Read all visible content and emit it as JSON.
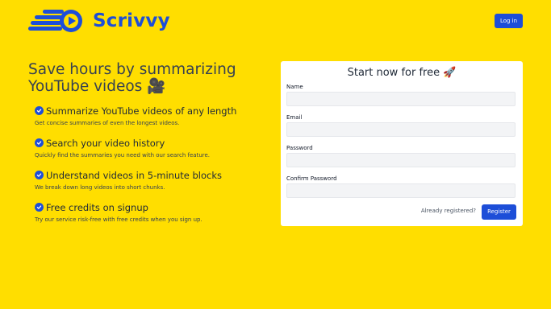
{
  "header": {
    "brand": "Scrivvy",
    "login_label": "Log in",
    "brand_color": "#1d4ed8"
  },
  "hero": {
    "title": "Save hours by summarizing YouTube videos 🎥"
  },
  "features": [
    {
      "title": "Summarize YouTube videos of any length",
      "desc": "Get concise summaries of even the longest videos.",
      "icon": "check-circle-icon"
    },
    {
      "title": "Search your video history",
      "desc": "Quickly find the summaries you need with our search feature.",
      "icon": "check-circle-icon"
    },
    {
      "title": "Understand videos in 5-minute blocks",
      "desc": "We break down long videos into short chunks.",
      "icon": "check-circle-icon"
    },
    {
      "title": "Free credits on signup",
      "desc": "Try our service risk-free with free credits when you sign up.",
      "icon": "check-circle-icon"
    }
  ],
  "form": {
    "title": "Start now for free 🚀",
    "fields": [
      {
        "label": "Name",
        "value": "",
        "placeholder": ""
      },
      {
        "label": "Email",
        "value": "",
        "placeholder": ""
      },
      {
        "label": "Password",
        "value": "",
        "placeholder": ""
      },
      {
        "label": "Confirm Password",
        "value": "",
        "placeholder": ""
      }
    ],
    "already_label": "Already registered?",
    "register_label": "Register"
  },
  "colors": {
    "background": "#ffde00",
    "accent": "#1d4ed8",
    "card": "#ffffff"
  }
}
